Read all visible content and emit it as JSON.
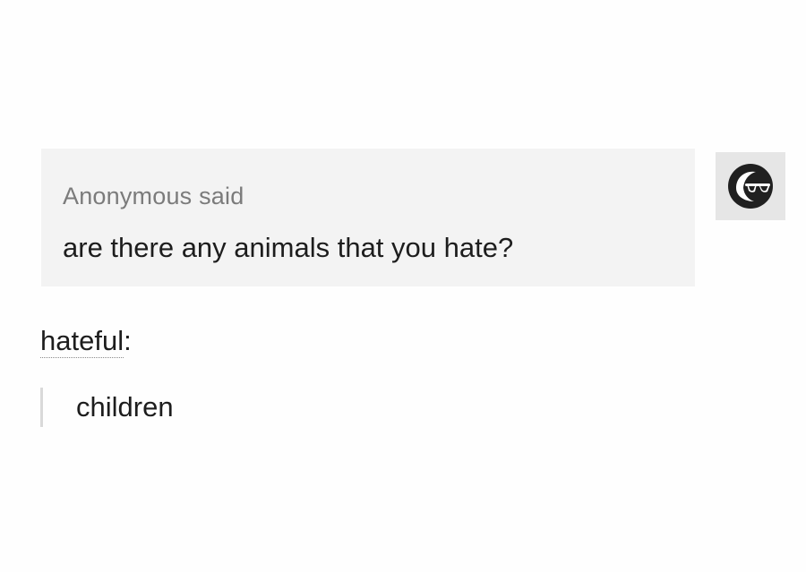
{
  "ask": {
    "asker": "Anonymous said",
    "question": "are there any animals that you hate?",
    "avatar_icon": "sunglasses-face-icon"
  },
  "answer": {
    "author": "hateful",
    "author_suffix": ":",
    "text": "children"
  },
  "colors": {
    "ask_background": "#f3f3f3",
    "avatar_background": "#e6e6e6",
    "asker_text": "#7b7b7b",
    "body_text": "#1d1d1d",
    "quote_bar": "#d9d9d9"
  }
}
